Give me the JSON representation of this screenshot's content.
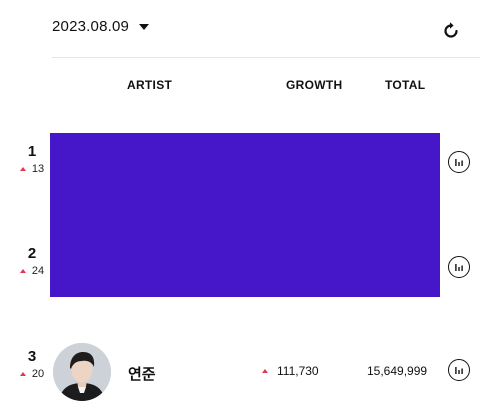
{
  "header": {
    "date": "2023.08.09",
    "refresh_icon": "refresh-icon",
    "dropdown_icon": "caret-down-icon"
  },
  "columns": {
    "artist": "ARTIST",
    "growth": "GROWTH",
    "total": "TOTAL"
  },
  "rows": [
    {
      "rank": "1",
      "change": "13",
      "change_direction": "up"
    },
    {
      "rank": "2",
      "change": "24",
      "change_direction": "up"
    },
    {
      "rank": "3",
      "change": "20",
      "change_direction": "up",
      "artist": "연준",
      "growth": "111,730",
      "total": "15,649,999"
    }
  ],
  "colors": {
    "accent_up": "#e0364e",
    "overlay": "#4617c9"
  }
}
